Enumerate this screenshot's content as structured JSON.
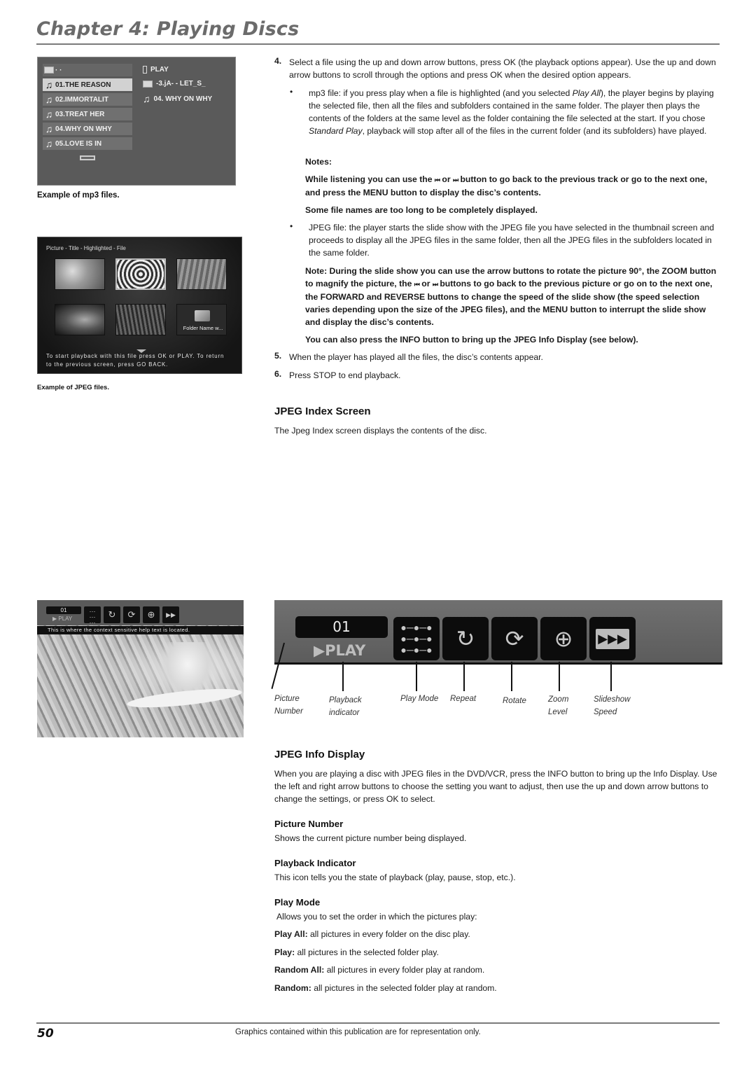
{
  "header": {
    "chapter_title": "Chapter 4: Playing Discs"
  },
  "mp3_screen": {
    "parent_folder_label": "· ·",
    "files": [
      {
        "label": "01.THE REASON",
        "selected": true
      },
      {
        "label": "02.IMMORTALIT",
        "selected": false
      },
      {
        "label": "03.TREAT HER",
        "selected": false
      },
      {
        "label": "04.WHY ON WHY",
        "selected": false
      },
      {
        "label": "05.LOVE IS IN",
        "selected": false
      }
    ],
    "right_panel": {
      "play_label": "PLAY",
      "folder_label": "-3.jA- - LET_S_",
      "file_label": "04. WHY ON WHY"
    },
    "caption": "Example of mp3 files."
  },
  "jpeg_screen": {
    "header": "Picture - Title - Highlighted - File",
    "folder_name": "Folder Name w...",
    "footer_line1": "To start playback with this file press OK or PLAY. To return",
    "footer_line2": "to the previous screen, press GO BACK.",
    "caption": "Example of JPEG files."
  },
  "steps": {
    "step4_num": "4.",
    "step4_text": "Select a file using the up and down arrow buttons, press OK (the playback options appear). Use the up and down arrow buttons to scroll through the options and press OK when the desired option appears.",
    "mp3_bullet_a": "mp3 file: if you press play when a file is highlighted (and you selected ",
    "mp3_bullet_italic1": "Play All",
    "mp3_bullet_b": "), the player begins by playing the selected file, then all the files and subfolders contained in the same folder. The player then plays the contents of the folders at the same level as the folder containing the file selected at the start. If you chose ",
    "mp3_bullet_italic2": "Standard Play",
    "mp3_bullet_c": ", playback will stop after all of the files in the current folder (and its subfolders) have played.",
    "notes_label": "Notes:",
    "note1_a": "While listening you can use the ",
    "note1_b": " or ",
    "note1_c": " button to go back to the previous track or go to the next one, and press the MENU button to display the disc’s contents.",
    "note2": "Some file names are too long to be completely displayed.",
    "jpeg_bullet": "JPEG file: the player starts the slide show with the JPEG file you have selected in the thumbnail screen and proceeds to display all the JPEG files in the same folder, then all the JPEG files in the subfolders located in the same folder.",
    "note3_a": "Note: During the slide show you can use the arrow buttons to rotate the picture 90°, the ZOOM button to magnify the picture, the ",
    "note3_b": " or ",
    "note3_c": " buttons to go back to the previous picture or go on to the next one, the FORWARD and REVERSE buttons to change the speed of the slide show (the speed selection varies depending upon the size of the JPEG files), and the MENU button to interrupt the slide show and display the disc’s contents.",
    "note4": "You can also press the INFO button to bring up the JPEG Info Display (see below).",
    "step5_num": "5.",
    "step5_text": "When the player has played all the files, the disc’s contents appear.",
    "step6_num": "6.",
    "step6_text": "Press STOP to end playback.",
    "prev_glyph": "⏮",
    "next_glyph": "⏭",
    "bullet_glyph": "•"
  },
  "jpeg_index": {
    "heading": "JPEG Index Screen",
    "text": "The Jpeg Index screen displays the contents of the disc."
  },
  "snow_screen": {
    "picture_number": "01",
    "play_label": "▶ PLAY",
    "help_text": "This is where the context sensitive help text is located."
  },
  "info_bar": {
    "picture_number": "01",
    "play_label": "▶PLAY",
    "icons": [
      "play-mode-icon",
      "repeat-icon",
      "rotate-icon",
      "zoom-icon",
      "slideshow-speed-icon"
    ],
    "callouts": [
      {
        "line1": "Picture",
        "line2": "Number"
      },
      {
        "line1": "Playback",
        "line2": "indicator"
      },
      {
        "line1": "Play Mode",
        "line2": ""
      },
      {
        "line1": "Repeat",
        "line2": ""
      },
      {
        "line1": "Rotate",
        "line2": ""
      },
      {
        "line1": "Zoom",
        "line2": "Level"
      },
      {
        "line1": "Slideshow",
        "line2": "Speed"
      }
    ]
  },
  "jpeg_info": {
    "heading": "JPEG Info Display",
    "intro": "When you are playing a disc with JPEG files in the DVD/VCR, press the INFO button to bring up the Info Display. Use the left and right arrow buttons to choose the setting you want to adjust, then use the up and down arrow buttons to change the settings, or press OK to select.",
    "picture_number_heading": "Picture Number",
    "picture_number_text": "Shows the current picture number being displayed.",
    "playback_indicator_heading": "Playback Indicator",
    "playback_indicator_text": "This icon tells you the state of playback (play, pause, stop, etc.).",
    "play_mode_heading": "Play Mode",
    "play_mode_text": "Allows you to set the order in which the pictures play:",
    "modes": [
      {
        "label": "Play All:",
        "text": " all pictures in every folder on the disc play."
      },
      {
        "label": "Play:",
        "text": " all pictures in the selected folder play."
      },
      {
        "label": "Random All:",
        "text": " all pictures in every folder play at random."
      },
      {
        "label": "Random:",
        "text": " all pictures in the selected folder play at random."
      }
    ]
  },
  "footer": {
    "page_number": "50",
    "note": "Graphics contained within this publication are for representation only."
  }
}
